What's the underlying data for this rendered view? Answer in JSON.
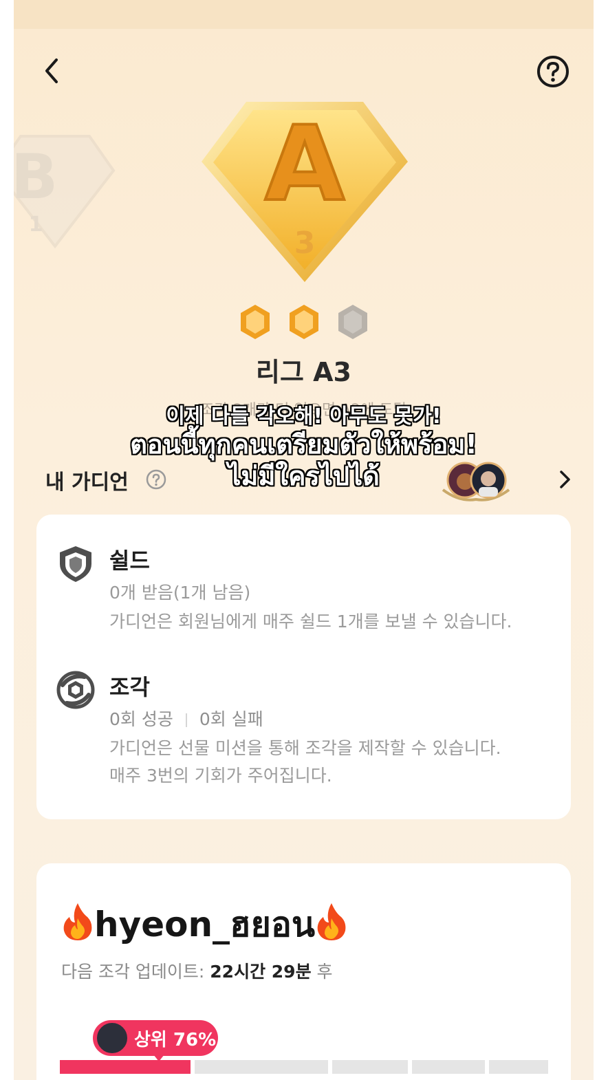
{
  "header": {
    "back_icon": "chevron-left-icon",
    "help_icon": "question-circle-icon"
  },
  "badges": {
    "prev": {
      "letter": "B",
      "level": "1"
    },
    "current": {
      "letter": "A",
      "level": "3"
    }
  },
  "gems": [
    {
      "state": "filled",
      "color": "#f0a020"
    },
    {
      "state": "filled",
      "color": "#f0a020"
    },
    {
      "state": "empty",
      "color": "#b8b2aa"
    }
  ],
  "league": {
    "title": "리그 A3",
    "subtitle": "조각 2개가 더 있으면 A2에 도달"
  },
  "overlay_caption": {
    "line1": "이제 다들 각오해! 아무도 못가!",
    "line2": "ตอนนี้ทุกคนเตรียมตัวให้พร้อม!",
    "line3": "ไม่มีใครไปได้"
  },
  "guardian": {
    "label": "내 가디언",
    "help_icon": "question-circle-icon",
    "chevron_icon": "chevron-right-icon"
  },
  "shield": {
    "title": "쉴드",
    "status": "0개 받음(1개 남음)",
    "desc": "가디언은 회원님에게 매주 쉴드 1개를 보낼 수 있습니다.",
    "icon": "shield-icon"
  },
  "piece": {
    "title": "조각",
    "success": "0회 성공",
    "fail": "0회 실패",
    "desc1": "가디언은 선물 미션을 통해 조각을 제작할 수 있습니다.",
    "desc2": "매주 3번의 기회가 주어집니다.",
    "icon": "piece-icon"
  },
  "user": {
    "name": "hyeon_ฮยอน",
    "update_label": "다음 조각 업데이트:",
    "update_time": "22시간 29분",
    "update_suffix": "후",
    "rank_label": "상위 76%"
  },
  "colors": {
    "accent": "#f0355f",
    "gold": "#f0a020"
  }
}
